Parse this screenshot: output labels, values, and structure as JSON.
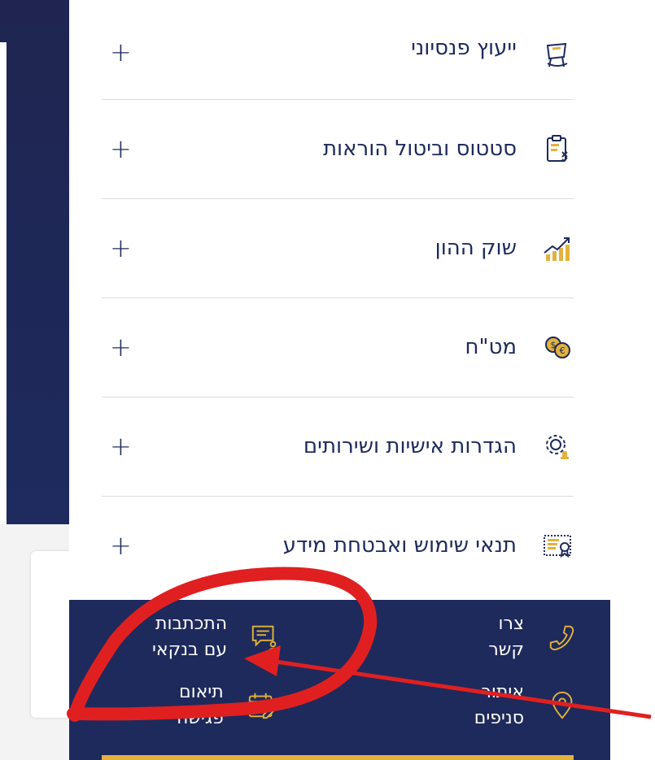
{
  "menu": {
    "items": [
      {
        "label": "ייעוץ פנסיוני",
        "icon": "pension-chair-icon"
      },
      {
        "label": "סטטוס וביטול הוראות",
        "icon": "clipboard-status-icon"
      },
      {
        "label": "שוק ההון",
        "icon": "stock-chart-icon"
      },
      {
        "label": "מט\"ח",
        "icon": "currency-coins-icon"
      },
      {
        "label": "הגדרות אישיות ושירותים",
        "icon": "settings-gear-icon"
      },
      {
        "label": "תנאי שימוש ואבטחת מידע",
        "icon": "certificate-icon"
      }
    ],
    "expand_symbol": "+"
  },
  "footer": {
    "contact": {
      "line1": "צרו",
      "line2": "קשר",
      "icon": "phone-icon"
    },
    "chat": {
      "line1": "התכתבות",
      "line2": "עם בנקאי",
      "icon": "chat-banker-icon"
    },
    "branches": {
      "line1": "איתור",
      "line2": "סניפים",
      "icon": "location-pin-icon"
    },
    "meeting": {
      "line1": "תיאום",
      "line2": "פגישה",
      "icon": "calendar-edit-icon"
    }
  },
  "colors": {
    "navy": "#1e2a5c",
    "gold": "#e3b23c",
    "annotation_red": "#e02020"
  }
}
